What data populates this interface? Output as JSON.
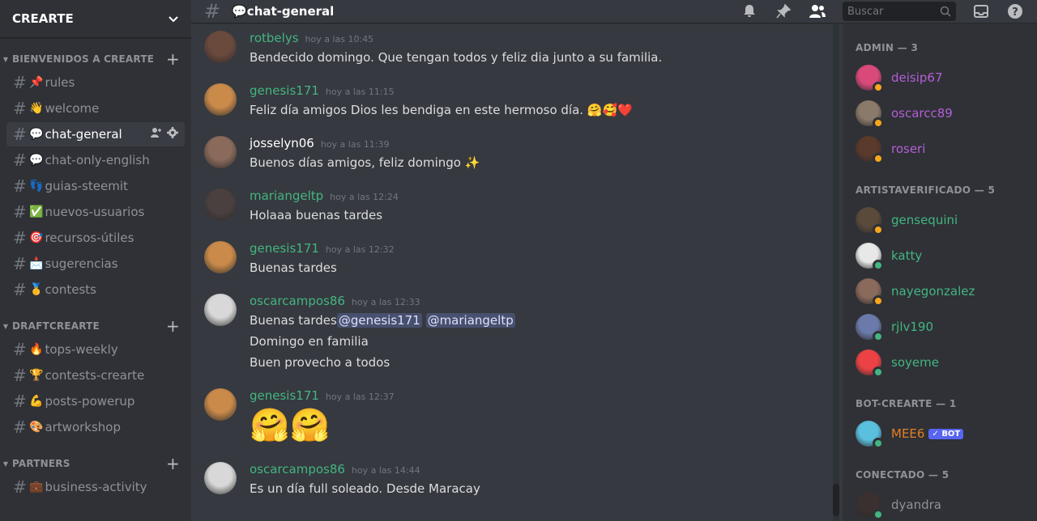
{
  "server": {
    "name": "CREARTE"
  },
  "categories": [
    {
      "name": "BIENVENIDOS A CREARTE",
      "channels": [
        {
          "emoji": "📌",
          "name": "rules"
        },
        {
          "emoji": "👋",
          "name": "welcome"
        },
        {
          "emoji": "💬",
          "name": "chat-general"
        },
        {
          "emoji": "💬",
          "name": "chat-only-english"
        },
        {
          "emoji": "👣",
          "name": "guias-steemit"
        },
        {
          "emoji": "✅",
          "name": "nuevos-usuarios"
        },
        {
          "emoji": "🎯",
          "name": "recursos-útiles"
        },
        {
          "emoji": "📩",
          "name": "sugerencias"
        },
        {
          "emoji": "🥇",
          "name": "contests"
        }
      ]
    },
    {
      "name": "DRAFTCREARTE",
      "channels": [
        {
          "emoji": "🔥",
          "name": "tops-weekly"
        },
        {
          "emoji": "🏆",
          "name": "contests-crearte"
        },
        {
          "emoji": "💪",
          "name": "posts-powerup"
        },
        {
          "emoji": "🎨",
          "name": "artworkshop"
        }
      ]
    },
    {
      "name": "PARTNERS",
      "channels": [
        {
          "emoji": "💼",
          "name": "business-activity"
        }
      ]
    }
  ],
  "topbar": {
    "channel_emoji": "💬",
    "channel_name": "chat-general",
    "search_placeholder": "Buscar"
  },
  "messages": [
    {
      "author": "rotbelys",
      "color": "#43b581",
      "time": "hoy a las 10:45",
      "lines": [
        "Bendecido domingo. Que tengan todos y feliz dia junto a su familia."
      ],
      "avatar": "#6b4a3e"
    },
    {
      "author": "genesis171",
      "color": "#43b581",
      "time": "hoy a las 11:15",
      "lines": [
        "Feliz día amigos Dios les bendiga en este hermoso día. 🤗🥰❤️"
      ],
      "avatar": "#c98a4a"
    },
    {
      "author": "josselyn06",
      "color": "#ffffff",
      "time": "hoy a las 11:39",
      "lines": [
        "Buenos días amigos, feliz domingo ✨"
      ],
      "avatar": "#8a6a5a"
    },
    {
      "author": "mariangeltp",
      "color": "#43b581",
      "time": "hoy a las 12:24",
      "lines": [
        "Holaaa buenas tardes"
      ],
      "avatar": "#4a4040"
    },
    {
      "author": "genesis171",
      "color": "#43b581",
      "time": "hoy a las 12:32",
      "lines": [
        "Buenas tardes"
      ],
      "avatar": "#c98a4a"
    },
    {
      "author": "oscarcampos86",
      "color": "#43b581",
      "time": "hoy a las 12:33",
      "lines": [
        "Buenas tardes",
        "Domingo en familia",
        "Buen provecho a todos"
      ],
      "mentions": [
        "@genesis171",
        "@mariangeltp"
      ],
      "avatar": "#d8d8d8"
    },
    {
      "author": "genesis171",
      "color": "#43b581",
      "time": "hoy a las 12:37",
      "big": "🤗🤗",
      "avatar": "#c98a4a"
    },
    {
      "author": "oscarcampos86",
      "color": "#43b581",
      "time": "hoy a las 14:44",
      "lines": [
        "Es un día full soleado. Desde Maracay"
      ],
      "avatar": "#d8d8d8"
    }
  ],
  "member_groups": [
    {
      "title": "ADMIN — 3",
      "members": [
        {
          "name": "deisip67",
          "color": "#b45ed6",
          "status": "#faa61a",
          "avatar": "#d94a7a"
        },
        {
          "name": "oscarcc89",
          "color": "#b45ed6",
          "status": "#faa61a",
          "avatar": "#8a7a6a"
        },
        {
          "name": "roseri",
          "color": "#b45ed6",
          "status": "#faa61a",
          "avatar": "#5a3a2a"
        }
      ]
    },
    {
      "title": "ARTISTAVERIFICADO — 5",
      "members": [
        {
          "name": "gensequini",
          "color": "#43b581",
          "status": "#faa61a",
          "avatar": "#5a4a3a"
        },
        {
          "name": "katty",
          "color": "#43b581",
          "status": "#43b581",
          "avatar": "#e8e8e8"
        },
        {
          "name": "nayegonzalez",
          "color": "#43b581",
          "status": "#faa61a",
          "avatar": "#8a6a5a"
        },
        {
          "name": "rjlv190",
          "color": "#43b581",
          "status": "#43b581",
          "avatar": "#6a7aaa"
        },
        {
          "name": "soyeme",
          "color": "#43b581",
          "status": "#43b581",
          "avatar": "#ed4245"
        }
      ]
    },
    {
      "title": "BOT-CREARTE — 1",
      "members": [
        {
          "name": "MEE6",
          "color": "#e67e22",
          "status": "#43b581",
          "avatar": "#5bc0de",
          "badge": "✓ BOT"
        }
      ]
    },
    {
      "title": "CONECTADO — 5",
      "members": [
        {
          "name": "dyandra",
          "color": "#8e9297",
          "status": "#43b581",
          "avatar": "#3a3030"
        }
      ]
    }
  ]
}
